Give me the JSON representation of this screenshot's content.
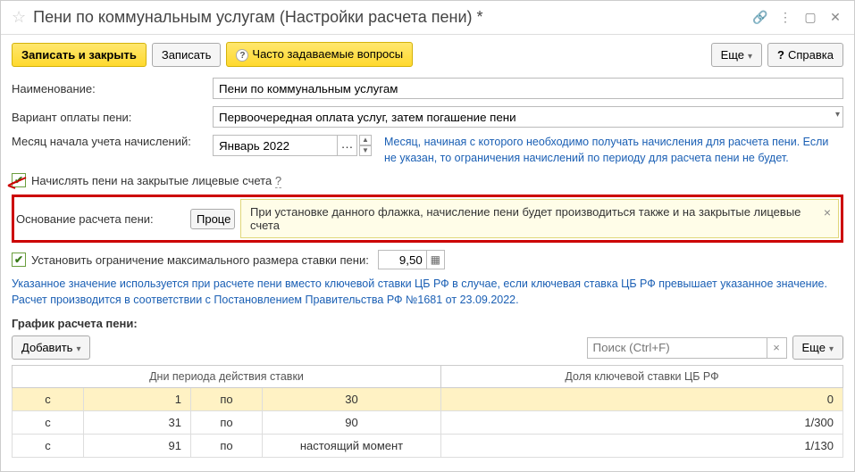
{
  "title": "Пени по коммунальным услугам (Настройки расчета пени) *",
  "toolbar": {
    "save_close": "Записать и закрыть",
    "save": "Записать",
    "faq": "Часто задаваемые вопросы",
    "more": "Еще",
    "help": "Справка"
  },
  "form": {
    "name_label": "Наименование:",
    "name_value": "Пени по коммунальным услугам",
    "variant_label": "Вариант оплаты пени:",
    "variant_value": "Первоочередная оплата услуг, затем погашение пени",
    "month_label": "Месяц начала учета начислений:",
    "month_value": "Январь 2022",
    "month_hint": "Месяц, начиная с которого необходимо получать начисления для расчета пени. Если не указан, то ограничения начислений по периоду для расчета пени не будет.",
    "closed_accounts_label": "Начислять пени на закрытые лицевые счета",
    "basis_label": "Основание расчета пени:",
    "basis_btn": "Проце",
    "tooltip_text": "При установке данного флажка, начисление пени будет производиться также и на закрытые лицевые счета",
    "max_rate_label": "Установить ограничение максимального размера ставки пени:",
    "max_rate_value": "9,50",
    "rate_info": "Указанное значение используется при расчете пени вместо ключевой ставки ЦБ РФ в случае, если ключевая ставка ЦБ РФ превышает указанное значение. Расчет производится в соответствии с Постановлением Правительства РФ №1681 от 23.09.2022.",
    "schedule_label": "График расчета пени:",
    "add_btn": "Добавить",
    "search_placeholder": "Поиск (Ctrl+F)"
  },
  "table": {
    "header1": "Дни периода действия ставки",
    "header2": "Доля ключевой ставки ЦБ РФ",
    "col_s": "с",
    "col_po": "по",
    "rows": [
      {
        "from": "1",
        "to": "30",
        "share": "0"
      },
      {
        "from": "31",
        "to": "90",
        "share": "1/300"
      },
      {
        "from": "91",
        "to": "настоящий момент",
        "share": "1/130"
      }
    ]
  }
}
